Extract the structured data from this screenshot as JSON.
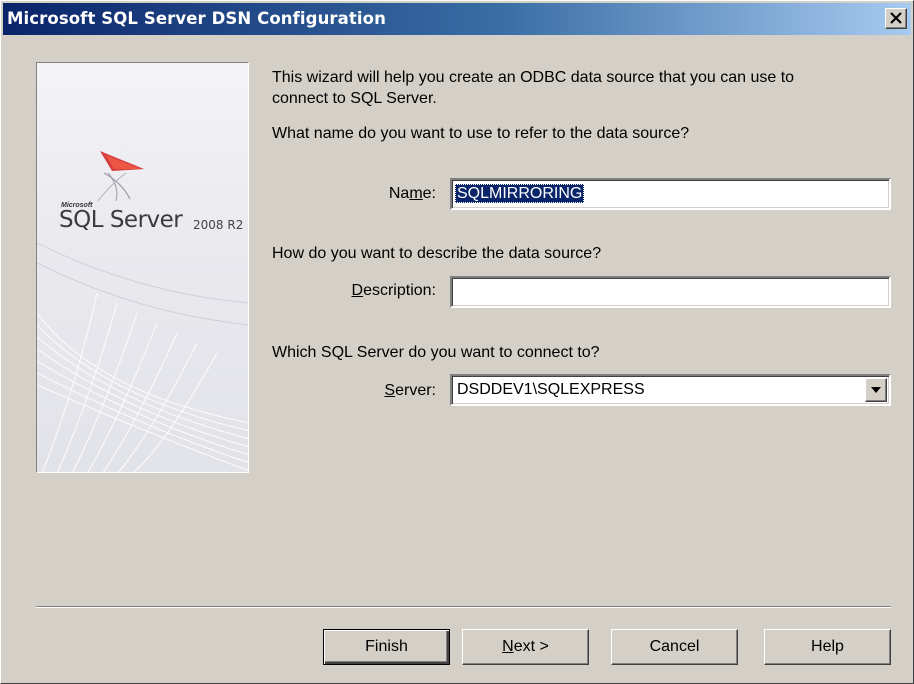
{
  "window": {
    "title": "Microsoft SQL Server DSN Configuration"
  },
  "branding": {
    "microsoft": "Microsoft",
    "product": "SQL Server",
    "version": "2008 R2"
  },
  "intro": {
    "line1": "This wizard will help you create an ODBC data source that you can use to",
    "line2": "connect to SQL Server.",
    "name_question": "What name do you want to use to refer to the data source?",
    "description_question": "How do you want to describe the data source?",
    "server_question": "Which SQL Server do you want to connect to?"
  },
  "form": {
    "name_label_pre": "Na",
    "name_label_key": "m",
    "name_label_post": "e:",
    "name_value": "SQLMIRRORING",
    "description_label_key": "D",
    "description_label_post": "escription:",
    "description_value": "",
    "server_label_key": "S",
    "server_label_post": "erver:",
    "server_value": "DSDDEV1\\SQLEXPRESS"
  },
  "buttons": {
    "finish": "Finish",
    "next_key": "N",
    "next_post": "ext >",
    "cancel": "Cancel",
    "help": "Help"
  },
  "icons": {
    "close": "close-icon",
    "dropdown": "chevron-down-icon",
    "logo": "sql-server-logo-icon"
  }
}
